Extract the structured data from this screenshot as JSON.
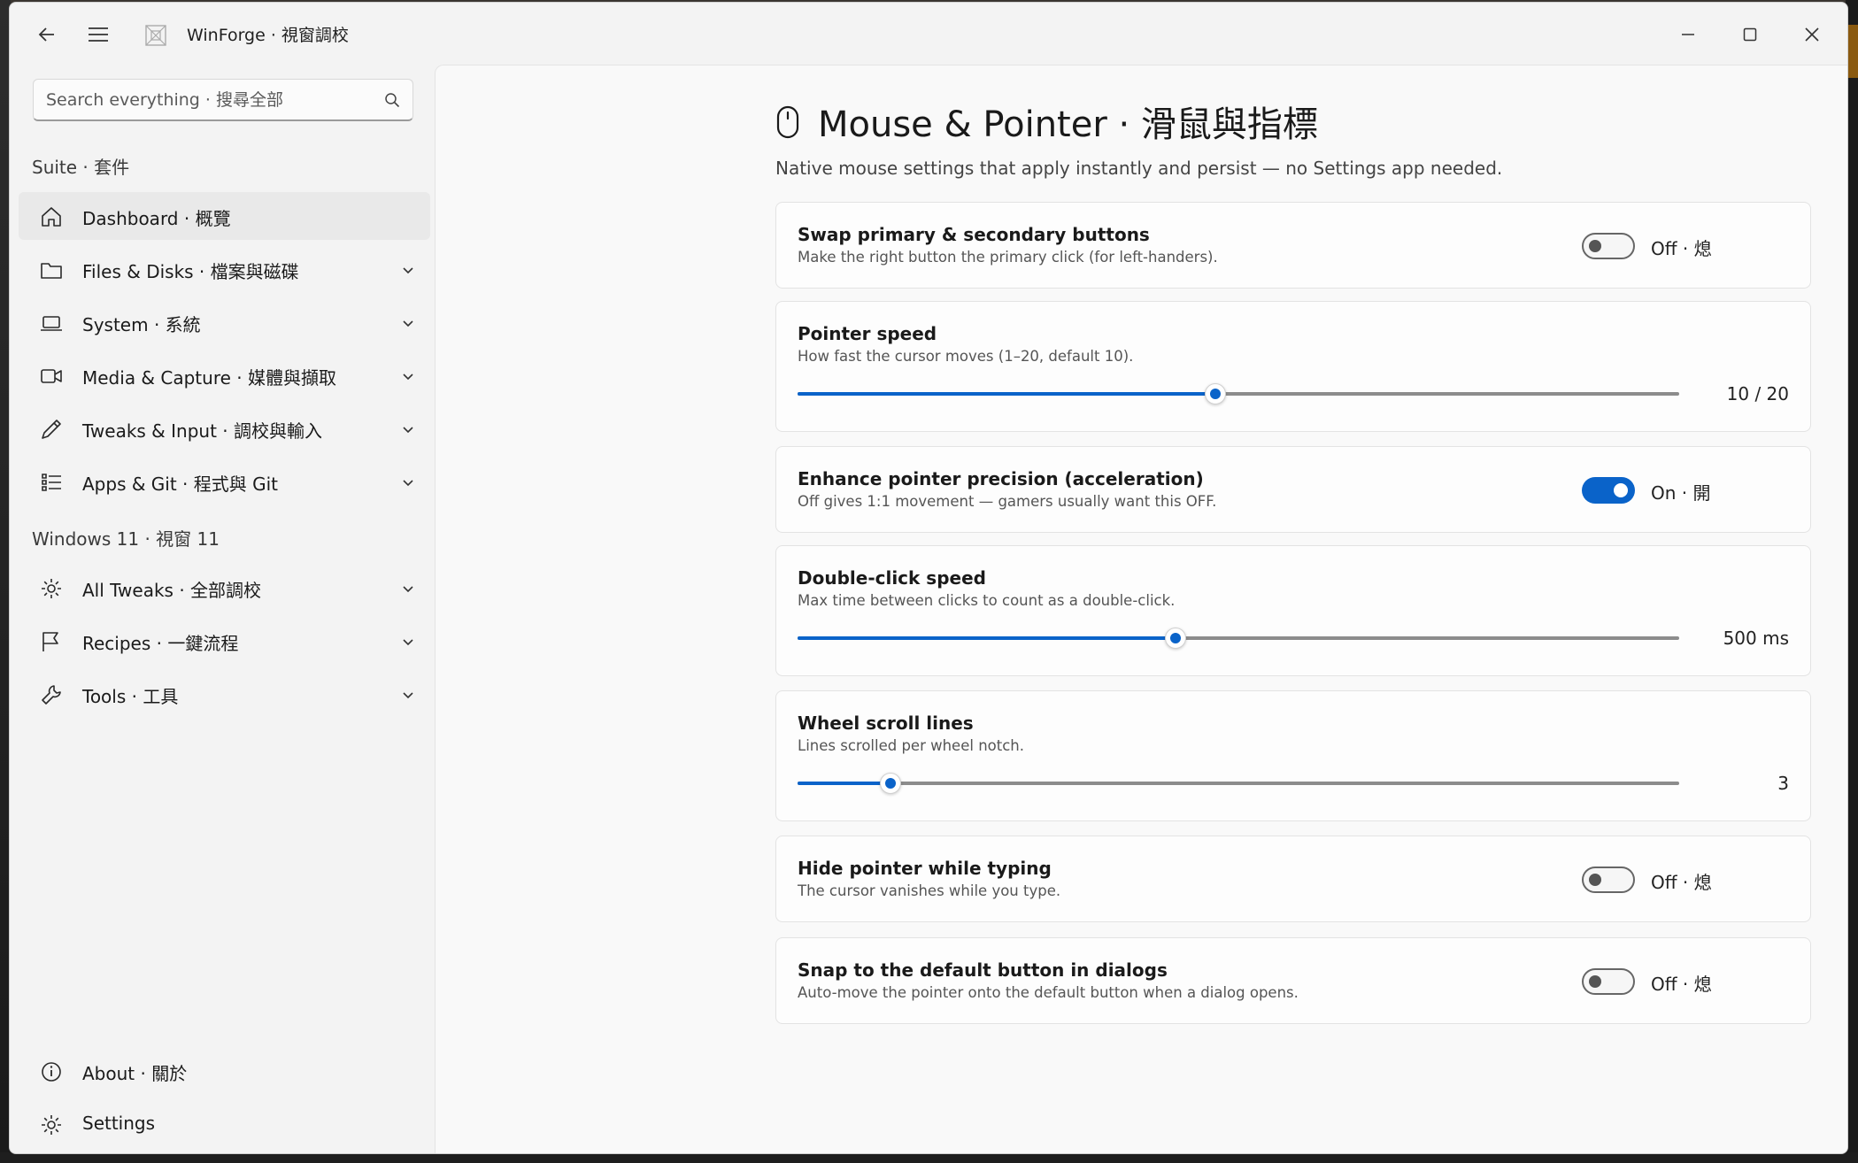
{
  "app": {
    "title": "WinForge · 視窗調校"
  },
  "search": {
    "placeholder": "Search everything · 搜尋全部"
  },
  "sidebar": {
    "section1": "Suite · 套件",
    "section2": "Windows 11 · 視窗 11",
    "items": [
      {
        "label": "Dashboard · 概覽",
        "icon": "home-icon",
        "active": true
      },
      {
        "label": "Files & Disks · 檔案與磁碟",
        "icon": "folder-icon"
      },
      {
        "label": "System · 系統",
        "icon": "laptop-icon"
      },
      {
        "label": "Media & Capture · 媒體與擷取",
        "icon": "video-camera-icon"
      },
      {
        "label": "Tweaks & Input · 調校與輸入",
        "icon": "pen-icon"
      },
      {
        "label": "Apps & Git · 程式與 Git",
        "icon": "list-icon"
      },
      {
        "label": "All Tweaks · 全部調校",
        "icon": "gear-icon"
      },
      {
        "label": "Recipes · 一鍵流程",
        "icon": "flag-icon"
      },
      {
        "label": "Tools · 工具",
        "icon": "wrench-icon"
      }
    ],
    "footer": [
      {
        "label": "About · 關於",
        "icon": "info-icon"
      },
      {
        "label": "Settings",
        "icon": "gear-icon"
      }
    ]
  },
  "page": {
    "title": "Mouse & Pointer · 滑鼠與指標",
    "subtitle": "Native mouse settings that apply instantly and persist — no Settings app needed.",
    "icon": "mouse-icon"
  },
  "settings": {
    "swap": {
      "title": "Swap primary & secondary buttons",
      "desc": "Make the right button the primary click (for left-handers).",
      "state": "Off · 熄",
      "on": false
    },
    "speed": {
      "title": "Pointer speed",
      "desc": "How fast the cursor moves (1–20, default 10).",
      "value": 10,
      "min": 1,
      "max": 20,
      "display": "10 / 20"
    },
    "precision": {
      "title": "Enhance pointer precision (acceleration)",
      "desc": "Off gives 1:1 movement — gamers usually want this OFF.",
      "state": "On · 開",
      "on": true
    },
    "doubleclick": {
      "title": "Double-click speed",
      "desc": "Max time between clicks to count as a double-click.",
      "value": 500,
      "min": 200,
      "max": 900,
      "display": "500 ms"
    },
    "wheel": {
      "title": "Wheel scroll lines",
      "desc": "Lines scrolled per wheel notch.",
      "value": 3,
      "min": 1,
      "max": 20,
      "display": "3"
    },
    "hide": {
      "title": "Hide pointer while typing",
      "desc": "The cursor vanishes while you type.",
      "state": "Off · 熄",
      "on": false
    },
    "snap": {
      "title": "Snap to the default button in dialogs",
      "desc": "Auto-move the pointer onto the default button when a dialog opens.",
      "state": "Off · 熄",
      "on": false
    }
  },
  "colors": {
    "accent": "#0a63c9"
  }
}
